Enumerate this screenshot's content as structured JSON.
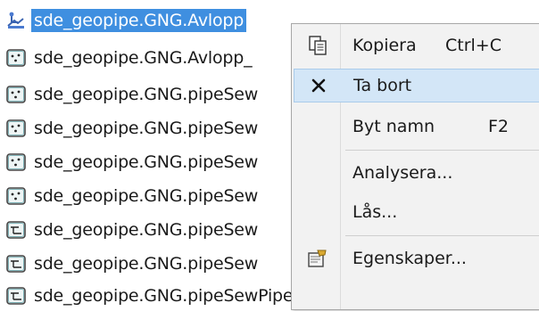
{
  "tree": {
    "items": [
      {
        "label": "sde_geopipe.GNG.Avlopp",
        "icon": "feature-dataset-icon",
        "selected": true
      },
      {
        "label": "sde_geopipe.GNG.Avlopp_",
        "icon": "point-feature-class-icon"
      },
      {
        "label": "sde_geopipe.GNG.pipeSew",
        "icon": "point-feature-class-icon"
      },
      {
        "label": "sde_geopipe.GNG.pipeSew",
        "icon": "point-feature-class-icon"
      },
      {
        "label": "sde_geopipe.GNG.pipeSew",
        "icon": "point-feature-class-icon"
      },
      {
        "label": "sde_geopipe.GNG.pipeSew",
        "icon": "point-feature-class-icon"
      },
      {
        "label": "sde_geopipe.GNG.pipeSew",
        "icon": "line-feature-class-icon"
      },
      {
        "label": "sde_geopipe.GNG.pipeSew",
        "icon": "line-feature-class-icon"
      },
      {
        "label": "sde_geopipe.GNG.pipeSewPipeParts",
        "icon": "line-feature-class-icon"
      }
    ]
  },
  "context_menu": {
    "items": [
      {
        "label": "Kopiera",
        "shortcut": "Ctrl+C",
        "icon": "copy-icon"
      },
      {
        "label": "Ta bort",
        "shortcut": "",
        "icon": "delete-x-icon",
        "highlighted": true
      },
      {
        "label": "Byt namn",
        "shortcut": "F2",
        "icon": ""
      },
      {
        "label": "Analysera...",
        "shortcut": "",
        "icon": ""
      },
      {
        "label": "Lås...",
        "shortcut": "",
        "icon": ""
      },
      {
        "label": "Egenskaper...",
        "shortcut": "",
        "icon": "properties-icon"
      }
    ]
  },
  "colors": {
    "selection": "#3f8fe0",
    "menu_highlight": "#d3e6f7",
    "menu_background": "#f2f2f2"
  }
}
